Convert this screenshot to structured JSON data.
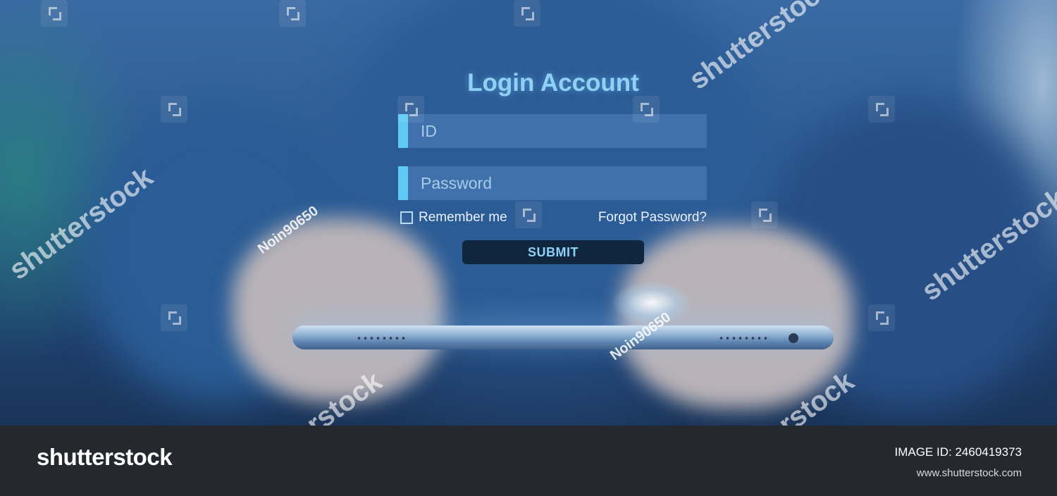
{
  "login": {
    "title": "Login Account",
    "id_placeholder": "ID",
    "password_placeholder": "Password",
    "remember_label": "Remember me",
    "forgot_label": "Forgot Password?",
    "submit_label": "SUBMIT"
  },
  "watermarks": {
    "brand": "shutterstock",
    "contributor": "Noin90650"
  },
  "footer": {
    "logo": "shutterstock",
    "image_id_label": "IMAGE ID:",
    "image_id": "2460419373",
    "site_url": "www.shutterstock.com"
  },
  "colors": {
    "accent": "#5ec8f7",
    "title": "#8fd0f5",
    "footer_bg": "#25282f"
  }
}
